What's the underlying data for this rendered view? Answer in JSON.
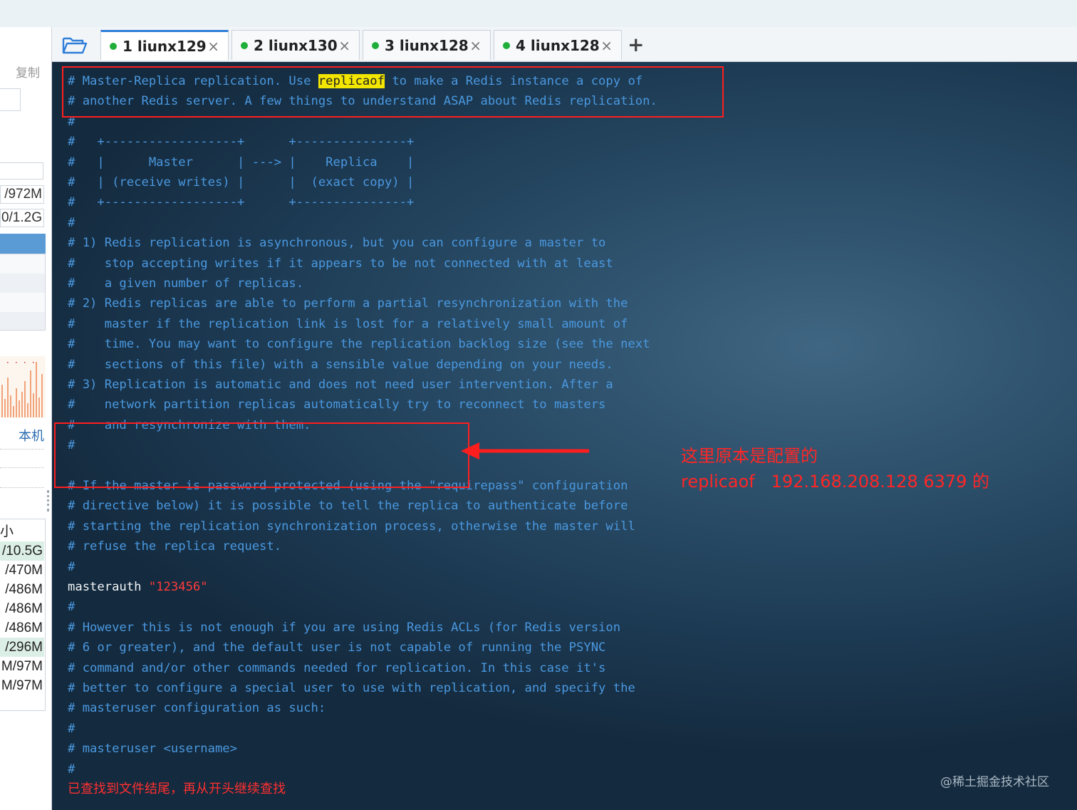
{
  "left_panel": {
    "copy_label": "复制",
    "stats": [
      "/972M",
      "0/1.2G"
    ],
    "local_label": "本机",
    "list_header": "小",
    "list_values": [
      "/10.5G",
      "/470M",
      "/486M",
      "/486M",
      "/486M",
      "/296M",
      "M/97M",
      "M/97M"
    ]
  },
  "tabs": [
    {
      "label": "1 liunx129",
      "status_color": "#1fae3a",
      "active": true
    },
    {
      "label": "2 liunx130",
      "status_color": "#1fae3a",
      "active": false
    },
    {
      "label": "3 liunx128",
      "status_color": "#1fae3a",
      "active": false
    },
    {
      "label": "4 liunx128",
      "status_color": "#1fae3a",
      "active": false
    }
  ],
  "tab_close_glyph": "×",
  "tab_add_glyph": "+",
  "terminal": {
    "line1_prefix": "# Master-Replica replication. Use ",
    "line1_highlight": "replicaof",
    "line1_suffix": " to make a Redis instance a copy of",
    "lines_block1": [
      "# another Redis server. A few things to understand ASAP about Redis replication.",
      "#",
      "#   +------------------+      +---------------+",
      "#   |      Master      | ---> |    Replica    |",
      "#   | (receive writes) |      |  (exact copy) |",
      "#   +------------------+      +---------------+",
      "#",
      "# 1) Redis replication is asynchronous, but you can configure a master to",
      "#    stop accepting writes if it appears to be not connected with at least",
      "#    a given number of replicas.",
      "# 2) Redis replicas are able to perform a partial resynchronization with the",
      "#    master if the replication link is lost for a relatively small amount of",
      "#    time. You may want to configure the replication backlog size (see the next",
      "#    sections of this file) with a sensible value depending on your needs.",
      "# 3) Replication is automatic and does not need user intervention. After a",
      "#    network partition replicas automatically try to reconnect to masters",
      "#    and resynchronize with them.",
      "#",
      "",
      "# If the master is password protected (using the \"requirepass\" configuration",
      "# directive below) it is possible to tell the replica to authenticate before",
      "# starting the replication synchronization process, otherwise the master will",
      "# refuse the replica request.",
      "#"
    ],
    "masterauth_key": "masterauth ",
    "masterauth_value": "\"123456\"",
    "lines_block2": [
      "#",
      "# However this is not enough if you are using Redis ACLs (for Redis version",
      "# 6 or greater), and the default user is not capable of running the PSYNC",
      "# command and/or other commands needed for replication. In this case it's",
      "# better to configure a special user to use with replication, and specify the",
      "# masteruser configuration as such:",
      "#",
      "# masteruser <username>",
      "#"
    ],
    "status_message": "已查找到文件结尾，再从开头继续查找"
  },
  "annotation": {
    "line1": "这里原本是配置的",
    "line2": "replicaof   192.168.208.128 6379 的"
  },
  "watermark": "@稀土掘金技术社区",
  "colors": {
    "comment": "#4a98df",
    "annotation_red": "#ff2626",
    "highlight_yellow": "#f2e600",
    "tab_active_border": "#2f7ed8"
  }
}
